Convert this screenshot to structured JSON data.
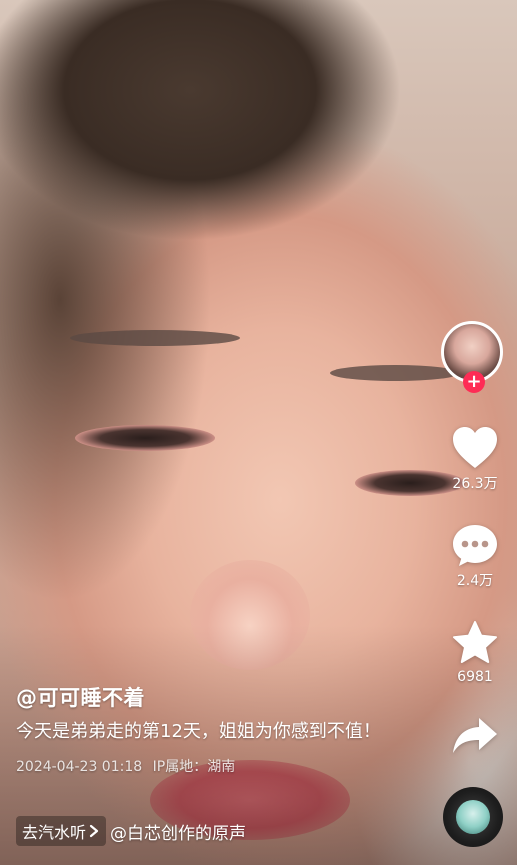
{
  "video": {
    "author": "@可可睡不着",
    "description": "今天是弟弟走的第12天，姐姐为你感到不值！",
    "date": "2024-04-23 01:18",
    "ip_location": "IP属地：湖南",
    "tag_label": "去汽水听",
    "music_text": "@白芯创作的原声"
  },
  "rail": {
    "follow_label": "+",
    "likes": "26.3万",
    "comments": "2.4万",
    "favorites": "6981"
  },
  "icons": {
    "like": "heart-icon",
    "comment": "comment-icon",
    "favorite": "star-icon",
    "share": "share-icon",
    "tag": "chevron-right-icon"
  },
  "colors": {
    "follow_accent": "#fe2c55",
    "text": "#ffffff"
  }
}
